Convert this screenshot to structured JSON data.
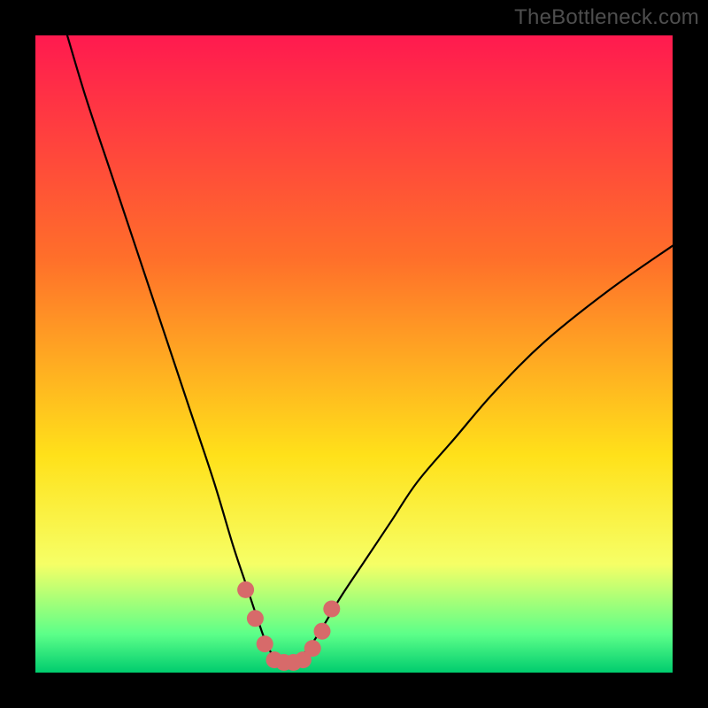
{
  "attribution": "TheBottleneck.com",
  "colors": {
    "gradient_top": "#ff1a4f",
    "gradient_upper_mid": "#ff6f2a",
    "gradient_mid": "#ffe11a",
    "gradient_lower": "#f6ff66",
    "gradient_green_light": "#5cff89",
    "gradient_green": "#00cc6e",
    "curve": "#000000",
    "marker": "#d76a6a",
    "frame": "#000000"
  },
  "chart_data": {
    "type": "line",
    "title": "",
    "xlabel": "",
    "ylabel": "",
    "xlim": [
      0,
      100
    ],
    "ylim": [
      0,
      100
    ],
    "series": [
      {
        "name": "bottleneck-curve",
        "x": [
          5,
          8,
          12,
          16,
          20,
          24,
          28,
          31,
          33,
          35,
          36.5,
          38,
          39.5,
          41,
          43,
          45,
          48,
          52,
          56,
          60,
          66,
          72,
          80,
          90,
          100
        ],
        "y": [
          100,
          90,
          78,
          66,
          54,
          42,
          30,
          20,
          14,
          8,
          4,
          2,
          2,
          2,
          4,
          7,
          12,
          18,
          24,
          30,
          37,
          44,
          52,
          60,
          67
        ]
      }
    ],
    "markers": [
      {
        "x": 33.0,
        "y": 13.0
      },
      {
        "x": 34.5,
        "y": 8.5
      },
      {
        "x": 36.0,
        "y": 4.5
      },
      {
        "x": 37.5,
        "y": 2.0
      },
      {
        "x": 39.0,
        "y": 1.6
      },
      {
        "x": 40.5,
        "y": 1.6
      },
      {
        "x": 42.0,
        "y": 2.0
      },
      {
        "x": 43.5,
        "y": 3.8
      },
      {
        "x": 45.0,
        "y": 6.5
      },
      {
        "x": 46.5,
        "y": 10.0
      }
    ],
    "gradient_stops": [
      {
        "offset": 0.0,
        "key": "gradient_top"
      },
      {
        "offset": 0.35,
        "key": "gradient_upper_mid"
      },
      {
        "offset": 0.66,
        "key": "gradient_mid"
      },
      {
        "offset": 0.83,
        "key": "gradient_lower"
      },
      {
        "offset": 0.94,
        "key": "gradient_green_light"
      },
      {
        "offset": 1.0,
        "key": "gradient_green"
      }
    ]
  }
}
